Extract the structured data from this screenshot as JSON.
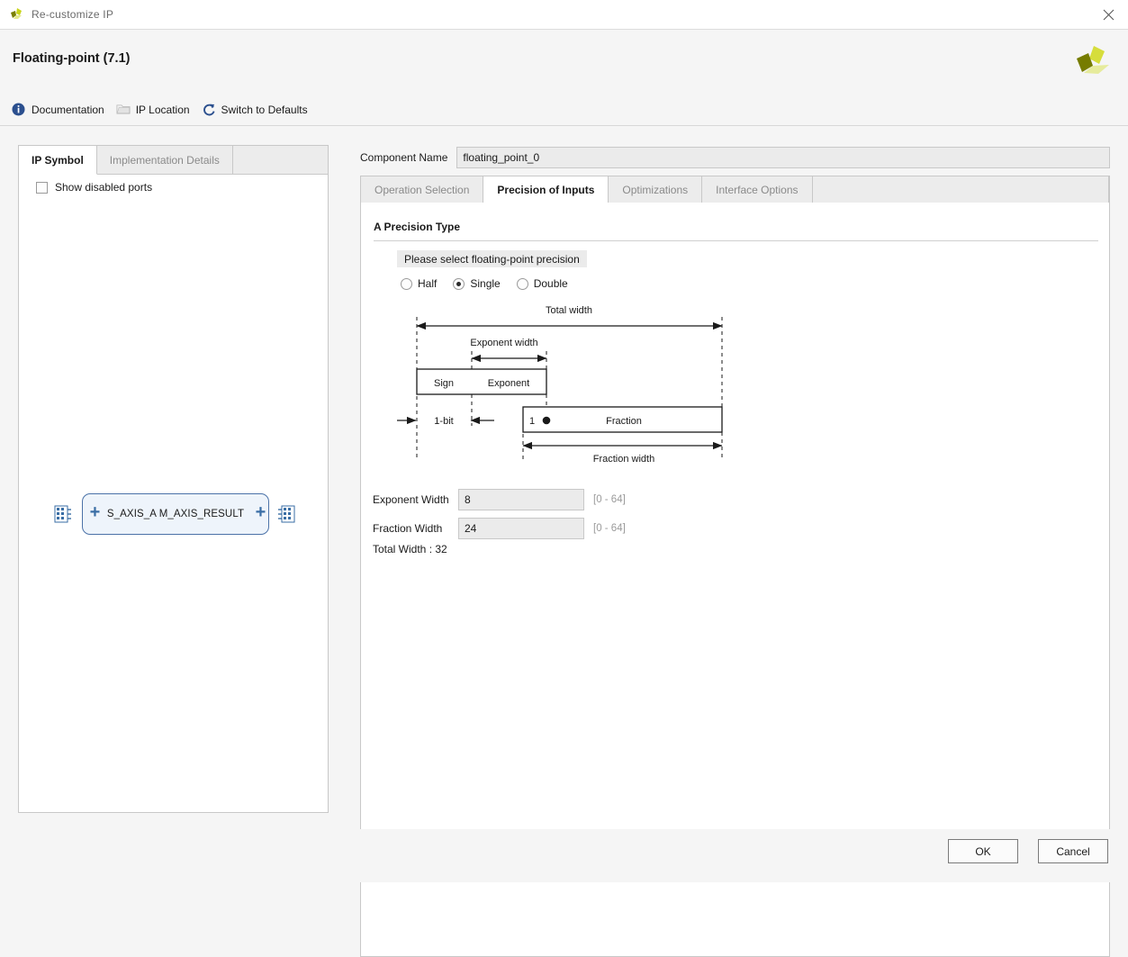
{
  "window": {
    "title": "Re-customize IP",
    "close_label": "✕",
    "app_icon": "xilinx-logo-icon"
  },
  "header": {
    "title": "Floating-point (7.1)",
    "logo": "xilinx-logo",
    "toolbar": [
      {
        "label": "Documentation",
        "icon": "info-icon"
      },
      {
        "label": "IP Location",
        "icon": "folder-icon"
      },
      {
        "label": "Switch to Defaults",
        "icon": "refresh-icon"
      }
    ]
  },
  "left_panel": {
    "tabs": [
      {
        "label": "IP Symbol",
        "active": true
      },
      {
        "label": "Implementation Details",
        "active": false
      }
    ],
    "show_disabled_ports": {
      "label": "Show disabled ports",
      "checked": false
    },
    "symbol": {
      "left_port": "S_AXIS_A",
      "right_port": "M_AXIS_RESULT",
      "full_label": "S_AXIS_A M_AXIS_RESULT"
    }
  },
  "right_panel": {
    "component_name": {
      "label": "Component Name",
      "value": "floating_point_0",
      "placeholder": "floating_point_0"
    },
    "tabs": [
      {
        "label": "Operation Selection",
        "active": false
      },
      {
        "label": "Precision of Inputs",
        "active": true
      },
      {
        "label": "Optimizations",
        "active": false
      },
      {
        "label": "Interface Options",
        "active": false
      }
    ],
    "section": {
      "title": "A Precision Type",
      "hint_pill": "Please select floating-point precision",
      "precision_options": [
        {
          "label": "Half",
          "selected": false
        },
        {
          "label": "Single",
          "selected": true
        },
        {
          "label": "Double",
          "selected": false
        }
      ]
    },
    "diagram": {
      "total_width_label": "Total width",
      "exponent_width_label": "Exponent width",
      "fraction_width_label": "Fraction width",
      "sign_label": "Sign",
      "exponent_label": "Exponent",
      "fraction_label": "Fraction",
      "one_bit_label": "1-bit",
      "implicit_one_label": "1"
    },
    "fields": [
      {
        "label": "Exponent Width",
        "value": "8",
        "hint": "[0 - 64]"
      },
      {
        "label": "Fraction Width",
        "value": "24",
        "hint": "[0 - 64]"
      }
    ],
    "total_width": "Total Width : 32"
  },
  "footer": {
    "ok_label": "OK",
    "cancel_label": "Cancel"
  },
  "colors": {
    "accent_blue": "#3a6ea5",
    "logo_green": "#c8d419",
    "logo_olive": "#7b8000",
    "panel_bg": "#f5f5f5",
    "field_bg": "#ebebeb"
  }
}
